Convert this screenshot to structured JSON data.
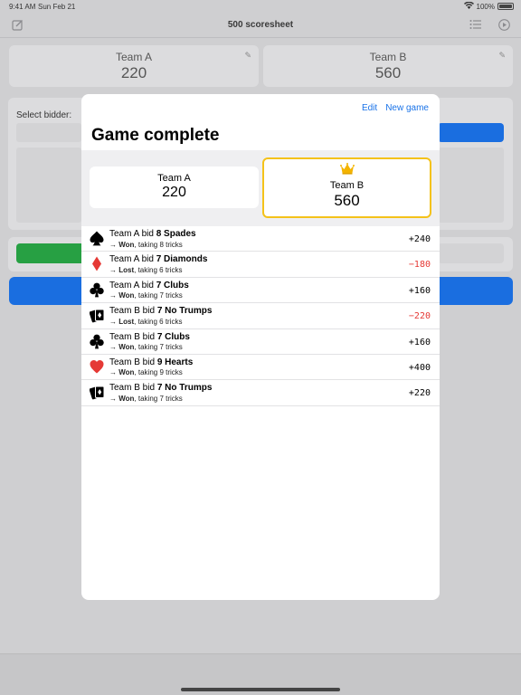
{
  "status_bar": {
    "time": "9:41 AM",
    "date": "Sun Feb 21",
    "battery": "100%"
  },
  "nav": {
    "title": "500 scoresheet"
  },
  "background": {
    "team_a": {
      "name": "Team A",
      "score": "220"
    },
    "team_b": {
      "name": "Team B",
      "score": "560"
    },
    "select_bidder_label": "Select bidder:"
  },
  "modal": {
    "edit_label": "Edit",
    "new_game_label": "New game",
    "title": "Game complete",
    "team_a": {
      "name": "Team A",
      "score": "220"
    },
    "team_b": {
      "name": "Team B",
      "score": "560",
      "winner": true
    },
    "rounds": [
      {
        "prefix": "Team A bid ",
        "bid": "8 Spades",
        "result": "Won",
        "detail": ", taking 8 tricks",
        "points": "+240",
        "suit": "spade-icon",
        "negative": false
      },
      {
        "prefix": "Team A bid ",
        "bid": "7 Diamonds",
        "result": "Lost",
        "detail": ", taking 6 tricks",
        "points": "−180",
        "suit": "diamond-icon",
        "negative": true
      },
      {
        "prefix": "Team A bid ",
        "bid": "7 Clubs",
        "result": "Won",
        "detail": ", taking 7 tricks",
        "points": "+160",
        "suit": "club-icon",
        "negative": false
      },
      {
        "prefix": "Team B bid ",
        "bid": "7 No Trumps",
        "result": "Lost",
        "detail": ", taking 6 tricks",
        "points": "−220",
        "suit": "cards-icon",
        "negative": true
      },
      {
        "prefix": "Team B bid ",
        "bid": "7 Clubs",
        "result": "Won",
        "detail": ", taking 7 tricks",
        "points": "+160",
        "suit": "club-icon",
        "negative": false
      },
      {
        "prefix": "Team B bid ",
        "bid": "9 Hearts",
        "result": "Won",
        "detail": ", taking 9 tricks",
        "points": "+400",
        "suit": "heart-icon",
        "negative": false
      },
      {
        "prefix": "Team B bid ",
        "bid": "7 No Trumps",
        "result": "Won",
        "detail": ", taking 7 tricks",
        "points": "+220",
        "suit": "cards-icon",
        "negative": false
      }
    ]
  },
  "colors": {
    "accent": "#1a73e8",
    "winner_border": "#f4c21a",
    "negative": "#e53935",
    "heart": "#e53935"
  }
}
